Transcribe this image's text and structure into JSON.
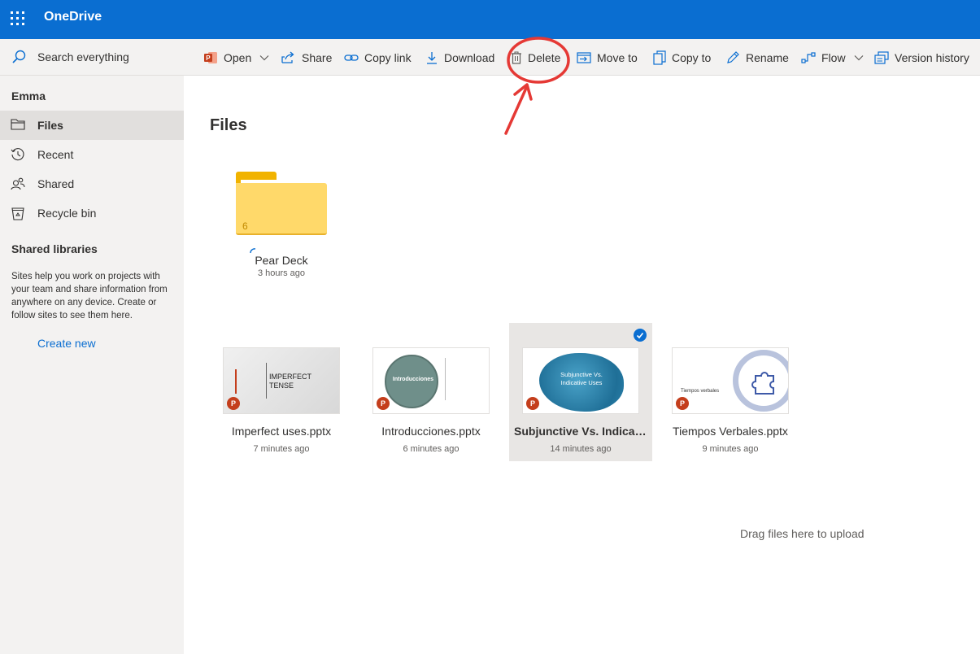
{
  "app": {
    "title": "OneDrive"
  },
  "search": {
    "placeholder": "Search everything"
  },
  "commands": {
    "open": "Open",
    "share": "Share",
    "copy_link": "Copy link",
    "download": "Download",
    "delete": "Delete",
    "move_to": "Move to",
    "copy_to": "Copy to",
    "rename": "Rename",
    "flow": "Flow",
    "version_history": "Version history"
  },
  "sidebar": {
    "user": "Emma",
    "items": [
      {
        "label": "Files",
        "icon": "folder-icon",
        "active": true
      },
      {
        "label": "Recent",
        "icon": "clock-icon"
      },
      {
        "label": "Shared",
        "icon": "people-icon"
      },
      {
        "label": "Recycle bin",
        "icon": "trash-icon"
      }
    ],
    "libraries_heading": "Shared libraries",
    "libraries_description": "Sites help you work on projects with your team and share information from anywhere on any device. Create or follow sites to see them here.",
    "create_new": "Create new"
  },
  "main": {
    "title": "Files",
    "folder": {
      "name": "Pear Deck",
      "modified": "3 hours ago",
      "count": "6"
    },
    "files": [
      {
        "name": "Imperfect uses.pptx",
        "modified": "7 minutes ago",
        "thumb_text": "IMPERFECT TENSE",
        "selected": false
      },
      {
        "name": "Introducciones.pptx",
        "modified": "6 minutes ago",
        "thumb_text": "Introducciones",
        "selected": false
      },
      {
        "name": "Subjunctive Vs. Indicati...",
        "modified": "14 minutes ago",
        "thumb_text": "Subjunctive Vs. Indicative Uses",
        "selected": true
      },
      {
        "name": "Tiempos Verbales.pptx",
        "modified": "9 minutes ago",
        "thumb_text": "Tiempos verbales",
        "selected": false
      }
    ],
    "drag_hint": "Drag files here to upload"
  },
  "colors": {
    "accent": "#0a6ed1",
    "annotation": "#e53935",
    "powerpoint": "#c43e1c",
    "folder": "#ffd96a"
  }
}
